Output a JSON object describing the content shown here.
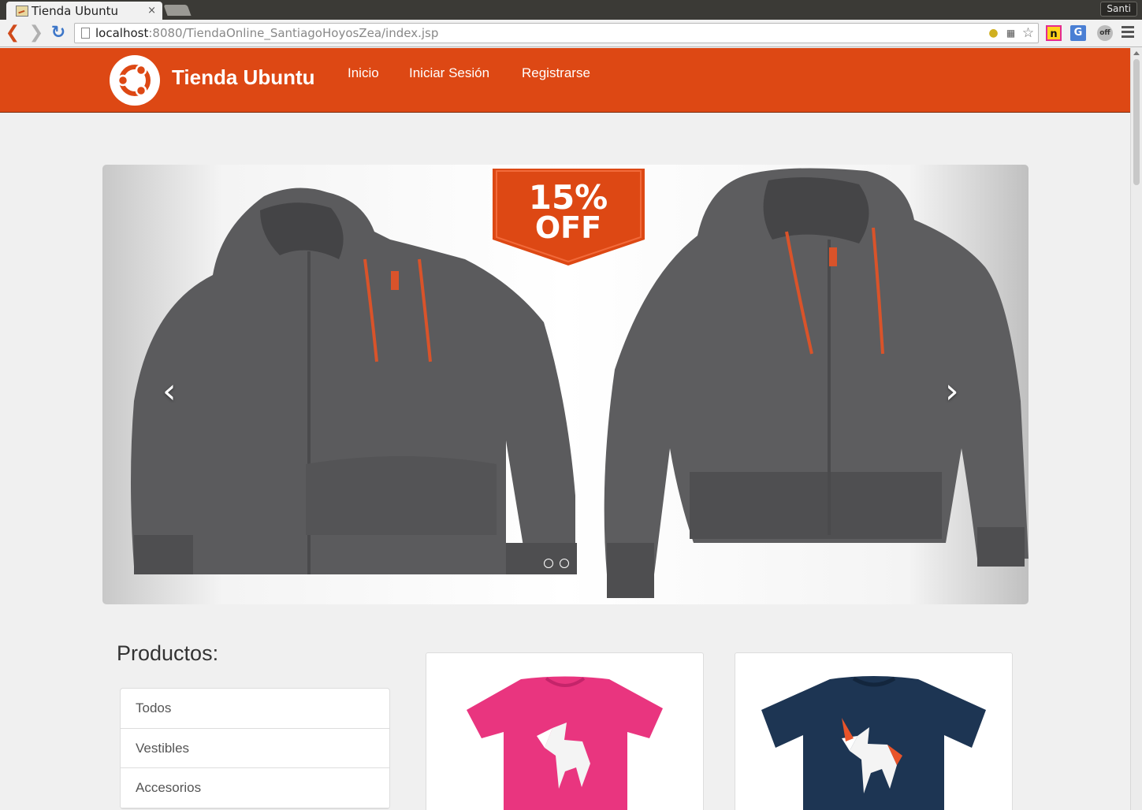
{
  "browser": {
    "tab_title": "Tienda Ubuntu",
    "tab_close": "×",
    "profile_name": "Santi",
    "url_host": "localhost",
    "url_rest": ":8080/TiendaOnline_SantiagoHoyosZea/index.jsp",
    "ext_n": "n",
    "ext_g": "G",
    "ext_off": "off"
  },
  "navbar": {
    "brand": "Tienda Ubuntu",
    "links": [
      "Inicio",
      "Iniciar Sesión",
      "Registrarse"
    ],
    "color": "#dd4814"
  },
  "carousel": {
    "badge_line1": "15%",
    "badge_line2": "OFF",
    "prev": "‹",
    "next": "›",
    "indicators": 2
  },
  "products": {
    "title": "Productos:",
    "categories": [
      "Todos",
      "Vestibles",
      "Accesorios"
    ]
  }
}
